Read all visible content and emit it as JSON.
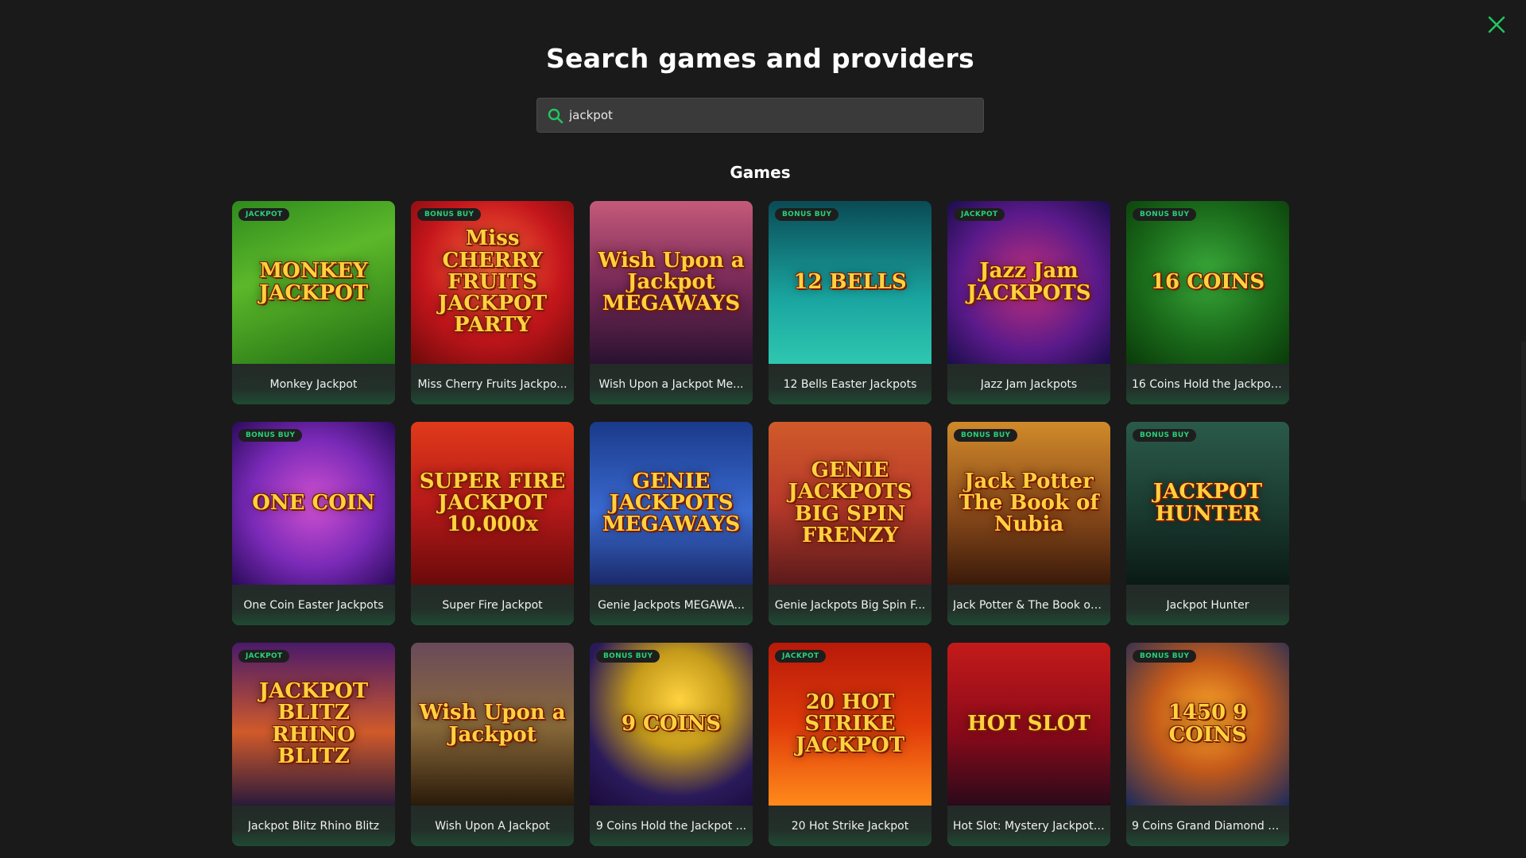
{
  "header": {
    "title": "Search games and providers",
    "close_icon": "close-icon",
    "close_color": "#22c55e"
  },
  "search": {
    "value": "jackpot",
    "icon": "search-icon",
    "icon_color": "#22c55e"
  },
  "games_section": {
    "title": "Games"
  },
  "colors": {
    "badge_text": "#29d07a",
    "background": "#1a1a1a",
    "card_bottom": "#1d8c52"
  },
  "games": [
    {
      "name": "Monkey Jackpot",
      "badge": "JACKPOT",
      "art": "MONKEY JACKPOT",
      "bg": "linear-gradient(160deg,#2f8a1e 0%,#5cb82a 40%,#1e6b12 100%)"
    },
    {
      "name": "Miss Cherry Fruits Jackpo...",
      "badge": "BONUS BUY",
      "art": "Miss CHERRY FRUITS JACKPOT PARTY",
      "bg": "radial-gradient(circle at 50% 40%,#ff6a3a 0%,#c4161c 55%,#6e0a0a 100%)"
    },
    {
      "name": "Wish Upon a Jackpot Me...",
      "badge": "",
      "art": "Wish Upon a Jackpot MEGAWAYS",
      "bg": "linear-gradient(180deg,#c45a7a 0%,#7a2a58 50%,#2a1230 100%)"
    },
    {
      "name": "12 Bells Easter Jackpots",
      "badge": "BONUS BUY",
      "art": "12 BELLS",
      "bg": "linear-gradient(180deg,#0a4a55 0%,#1aa5a0 60%,#2ec7b0 100%)"
    },
    {
      "name": "Jazz Jam Jackpots",
      "badge": "JACKPOT",
      "art": "Jazz Jam JACKPOTS",
      "bg": "radial-gradient(circle at 50% 50%,#c2307a 0%,#5a1a8a 60%,#1a0d4a 100%)"
    },
    {
      "name": "16 Coins Hold the Jackpot...",
      "badge": "BONUS BUY",
      "art": "16 COINS",
      "bg": "radial-gradient(circle at 50% 45%,#3aaa3a 0%,#1a6a1a 55%,#0a3a0a 100%)"
    },
    {
      "name": "One Coin Easter Jackpots",
      "badge": "BONUS BUY",
      "art": "ONE COIN",
      "bg": "radial-gradient(circle at 50% 50%,#d050d0 0%,#7a2ab8 55%,#2a0a5a 100%)"
    },
    {
      "name": "Super Fire Jackpot",
      "badge": "",
      "art": "SUPER FIRE JACKPOT 10.000x",
      "bg": "linear-gradient(180deg,#e03a1a 0%,#b81a1a 50%,#6a0a0a 100%)"
    },
    {
      "name": "Genie Jackpots MEGAWA...",
      "badge": "",
      "art": "GENIE JACKPOTS MEGAWAYS",
      "bg": "linear-gradient(180deg,#1a3a8a 0%,#3a6ad0 55%,#1a2a6a 100%)"
    },
    {
      "name": "Genie Jackpots Big Spin F...",
      "badge": "",
      "art": "GENIE JACKPOTS BIG SPIN FRENZY",
      "bg": "linear-gradient(180deg,#d05a2a 0%,#b83a2a 50%,#5a1a1a 100%)"
    },
    {
      "name": "Jack Potter & The Book of ...",
      "badge": "BONUS BUY",
      "art": "Jack Potter The Book of Nubia",
      "bg": "linear-gradient(180deg,#d08a2a 0%,#8a4a1a 55%,#3a1a0a 100%)"
    },
    {
      "name": "Jackpot Hunter",
      "badge": "BONUS BUY",
      "art": "JACKPOT HUNTER",
      "bg": "linear-gradient(180deg,#2a5a4a 0%,#1a3a30 55%,#0a1a15 100%)"
    },
    {
      "name": "Jackpot Blitz Rhino Blitz",
      "badge": "JACKPOT",
      "art": "JACKPOT BLITZ RHINO BLITZ",
      "bg": "linear-gradient(180deg,#4a1a6a 0%,#d05a2a 55%,#2a1a3a 100%)"
    },
    {
      "name": "Wish Upon A Jackpot",
      "badge": "",
      "art": "Wish Upon a Jackpot",
      "bg": "linear-gradient(180deg,#6a4a5a 0%,#8a6a3a 50%,#2a1a0a 100%)"
    },
    {
      "name": "9 Coins Hold the Jackpot ...",
      "badge": "BONUS BUY",
      "art": "9 COINS",
      "bg": "radial-gradient(circle at 55% 35%,#ffd23f 0%,#c49a1a 35%,#2a1a5a 70%,#1a0a3a 100%)"
    },
    {
      "name": "20 Hot Strike Jackpot",
      "badge": "JACKPOT",
      "art": "20 HOT STRIKE JACKPOT",
      "bg": "linear-gradient(180deg,#b81a0a 0%,#e03a0a 50%,#ff8a1a 100%)"
    },
    {
      "name": "Hot Slot: Mystery Jackpot ...",
      "badge": "",
      "art": "HOT SLOT",
      "bg": "linear-gradient(180deg,#c41a1a 0%,#8a0a1a 55%,#2a0a1a 100%)"
    },
    {
      "name": "9 Coins Grand Diamond E...",
      "badge": "BONUS BUY",
      "art": "1450 9 COINS",
      "bg": "radial-gradient(circle at 50% 45%,#ffaa2a 0%,#c45a1a 45%,#1a2a5a 100%)"
    }
  ]
}
